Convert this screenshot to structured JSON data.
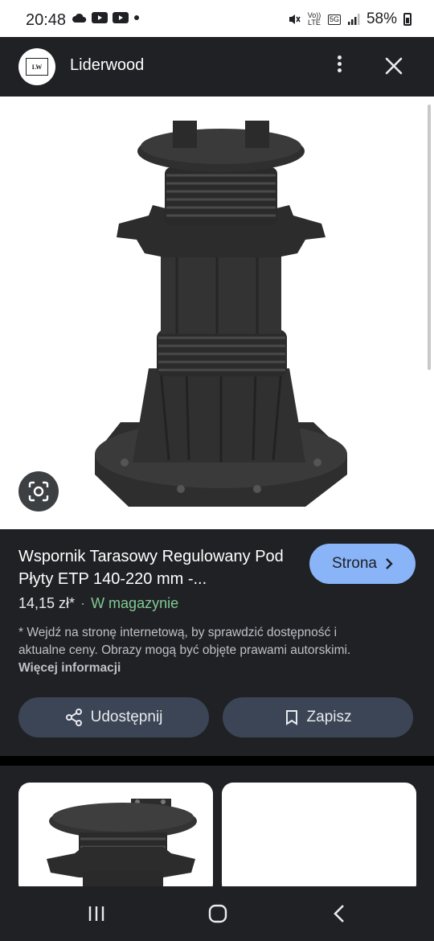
{
  "status_bar": {
    "time": "20:48",
    "volte": "Vo)) LTE",
    "network": "5G",
    "battery": "58%"
  },
  "app_bar": {
    "logo_text": "LW",
    "title": "Liderwood"
  },
  "product": {
    "title": "Wspornik Tarasowy Regulowany Pod Płyty ETP 140-220 mm -...",
    "visit_button": "Strona",
    "price": "14,15 zł*",
    "separator": "·",
    "availability": "W magazynie",
    "disclaimer": "* Wejdź na stronę internetową, by sprawdzić dostępność i aktualne ceny. Obrazy mogą być objęte prawami autorskimi.",
    "more_info": "Więcej informacji",
    "share_button": "Udostępnij",
    "save_button": "Zapisz"
  },
  "colors": {
    "background": "#202124",
    "accent_button": "#8ab4f8",
    "stock_green": "#81c995",
    "secondary_button": "#3c4556"
  }
}
